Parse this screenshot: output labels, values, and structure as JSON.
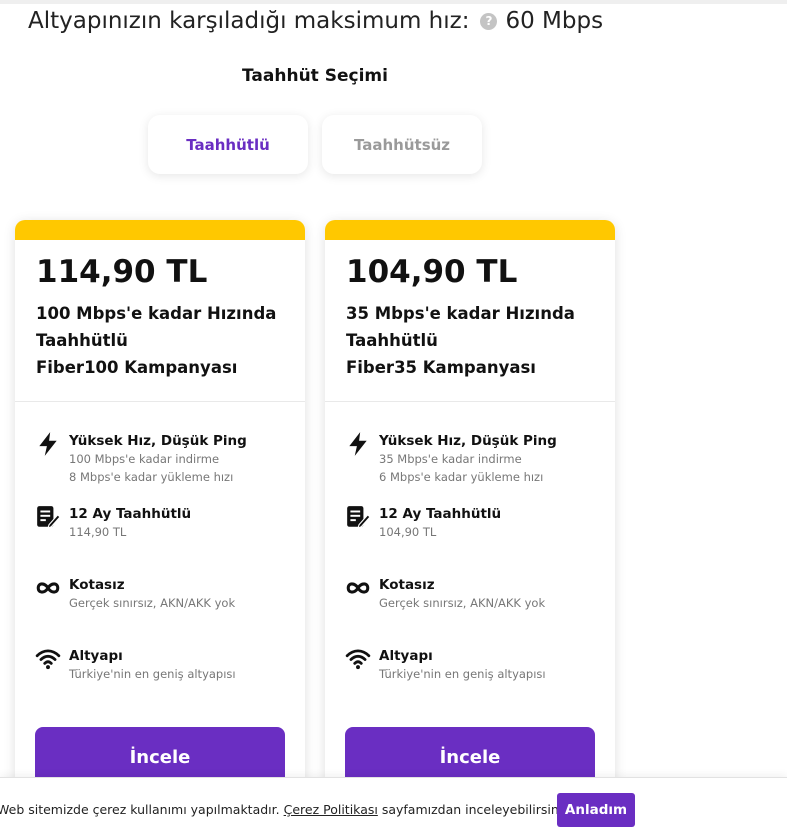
{
  "header": {
    "max_speed_label": "Altyapınızın karşıladığı maksimum hız:",
    "help_icon": "question-circle-icon",
    "max_speed_value": "60 Mbps"
  },
  "commitment": {
    "title": "Taahhüt Seçimi",
    "options": [
      "Taahhütlü",
      "Taahhütsüz"
    ],
    "selected": "Taahhütlü"
  },
  "plans": [
    {
      "price": "114,90 TL",
      "title_lines": [
        "100 Mbps'e kadar Hızında",
        "Taahhütlü",
        "Fiber100 Kampanyası"
      ],
      "features": [
        {
          "icon": "lightning-icon",
          "name": "Yüksek Hız, Düşük Ping",
          "desc": [
            "100 Mbps'e kadar indirme",
            "8 Mbps'e kadar yükleme hızı"
          ]
        },
        {
          "icon": "contract-icon",
          "name": "12 Ay Taahhütlü",
          "desc": [
            "114,90 TL"
          ]
        },
        {
          "icon": "infinity-icon",
          "name": "Kotasız",
          "desc": [
            "Gerçek sınırsız, AKN/AKK yok"
          ]
        },
        {
          "icon": "wifi-icon",
          "name": "Altyapı",
          "desc": [
            "Türkiye'nin en geniş altyapısı"
          ]
        }
      ],
      "button": "İncele"
    },
    {
      "price": "104,90 TL",
      "title_lines": [
        "35 Mbps'e kadar Hızında",
        "Taahhütlü",
        "Fiber35 Kampanyası"
      ],
      "features": [
        {
          "icon": "lightning-icon",
          "name": "Yüksek Hız, Düşük Ping",
          "desc": [
            "35 Mbps'e kadar indirme",
            "6 Mbps'e kadar yükleme hızı"
          ]
        },
        {
          "icon": "contract-icon",
          "name": "12 Ay Taahhütlü",
          "desc": [
            "104,90 TL"
          ]
        },
        {
          "icon": "infinity-icon",
          "name": "Kotasız",
          "desc": [
            "Gerçek sınırsız, AKN/AKK yok"
          ]
        },
        {
          "icon": "wifi-icon",
          "name": "Altyapı",
          "desc": [
            "Türkiye'nin en geniş altyapısı"
          ]
        }
      ],
      "button": "İncele"
    }
  ],
  "cookie": {
    "text_before": "Web sitemizde çerez kullanımı yapılmaktadır.",
    "link": "Çerez Politikası",
    "text_after": "sayfamızdan inceleyebilirsiniz.",
    "button": "Anladım"
  },
  "colors": {
    "accent": "#6a2ec2",
    "card_top_bar": "#ffc800",
    "inactive_text": "#9a9a9a"
  }
}
